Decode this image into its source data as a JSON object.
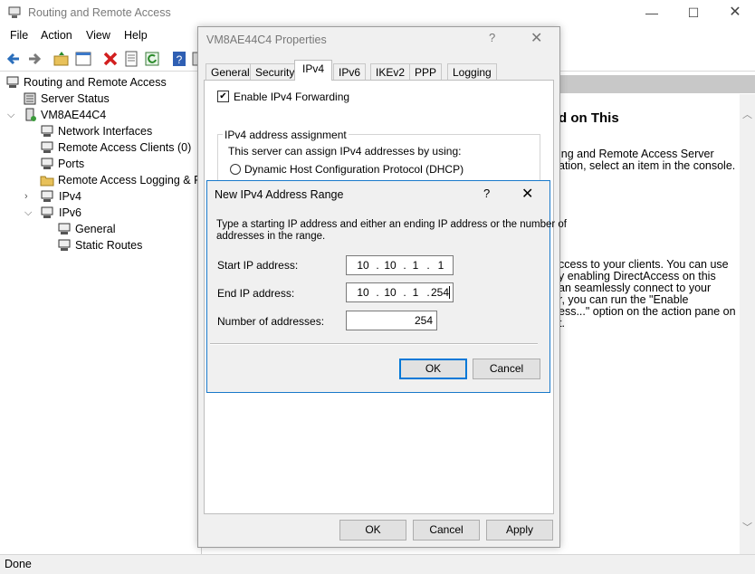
{
  "app": {
    "title": "Routing and Remote Access"
  },
  "menu": [
    "File",
    "Action",
    "View",
    "Help"
  ],
  "tree": {
    "root": "Routing and Remote Access",
    "server_status": "Server Status",
    "server": "VM8AE44C4",
    "children": [
      "Network Interfaces",
      "Remote Access Clients (0)",
      "Ports",
      "Remote Access Logging & Po",
      "IPv4",
      "IPv6"
    ],
    "ipv6_children": [
      "General",
      "Static Routes"
    ]
  },
  "right_pane": {
    "heading": "d on This",
    "lines": [
      "ing and Remote Access Server",
      "ation, select an item in the console.",
      "ccess to your clients. You can use",
      "y enabling DirectAccess on this",
      "an seamlessly connect to your",
      "r, you can run the \"Enable",
      "ess...\" option on the action pane on",
      "t."
    ]
  },
  "status": "Done",
  "properties": {
    "title": "VM8AE44C4 Properties",
    "help": "?",
    "tabs": [
      "General",
      "Security",
      "IPv4",
      "IPv6",
      "IKEv2",
      "PPP",
      "Logging"
    ],
    "active_tab": "IPv4",
    "enable_forwarding": {
      "label": "Enable IPv4 Forwarding",
      "checked": true
    },
    "group_title": "IPv4 address assignment",
    "group_text": "This server can assign IPv4 addresses by using:",
    "dhcp_option": "Dynamic Host Configuration Protocol (DHCP)",
    "ok": "OK",
    "cancel": "Cancel",
    "apply": "Apply"
  },
  "range_dialog": {
    "title": "New IPv4 Address Range",
    "help": "?",
    "instructions_1": "Type a starting IP address and either an ending IP address or the number of",
    "instructions_2": "addresses in the range.",
    "start_label": "Start IP address:",
    "start_ip": [
      "10",
      "10",
      "1",
      "1"
    ],
    "end_label": "End IP address:",
    "end_ip": [
      "10",
      "10",
      "1",
      "254"
    ],
    "count_label": "Number of addresses:",
    "count": "254",
    "ok": "OK",
    "cancel": "Cancel"
  }
}
